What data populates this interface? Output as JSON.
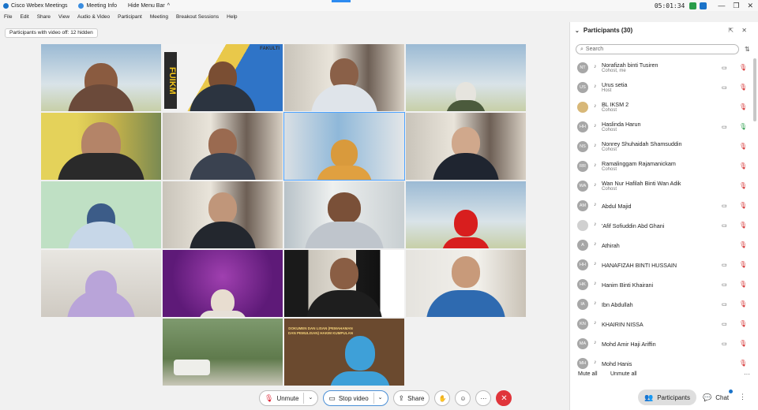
{
  "titlebar": {
    "app_name": "Cisco Webex Meetings",
    "meeting_info": "Meeting Info",
    "hide_menu_bar": "Hide Menu Bar",
    "chevron": "^",
    "timer": "05:01:34",
    "minimize": "—",
    "restore": "❐",
    "close": "✕"
  },
  "menubar": [
    "File",
    "Edit",
    "Share",
    "View",
    "Audio & Video",
    "Participant",
    "Meeting",
    "Breakout Sessions",
    "Help"
  ],
  "hidden_notice": "Participants with video off: 12 hidden",
  "toolbar": {
    "unmute": "Unmute",
    "stop_video": "Stop video",
    "share": "Share",
    "caret": "⌄",
    "reactions_icon": "☺",
    "more_icon": "···",
    "end_icon": "✕"
  },
  "panel": {
    "title": "Participants (30)",
    "search_placeholder": "Search",
    "mute_all": "Mute all",
    "unmute_all": "Unmute all",
    "participants_tab": "Participants",
    "chat_tab": "Chat",
    "participants": [
      {
        "initials": "NT",
        "name": "Norafizah binti Tusiren",
        "role": "Cohost, me",
        "cam": true,
        "mic": "muted"
      },
      {
        "initials": "US",
        "name": "Urus setia",
        "role": "Host",
        "cam": true,
        "mic": "muted"
      },
      {
        "initials": "",
        "name": "BL IKSM 2",
        "role": "Cohost",
        "cam": false,
        "mic": "muted",
        "image": true
      },
      {
        "initials": "HH",
        "name": "Haslinda Harun",
        "role": "Cohost",
        "cam": true,
        "mic": "on"
      },
      {
        "initials": "NS",
        "name": "Nonrey Shuhaidah Shamsuddin",
        "role": "Cohost",
        "cam": false,
        "mic": "muted"
      },
      {
        "initials": "RR",
        "name": "Ramalinggam Rajamanickam",
        "role": "Cohost",
        "cam": false,
        "mic": "muted"
      },
      {
        "initials": "WA",
        "name": "Wan Nur Hafilah Binti Wan Adik",
        "role": "Cohost",
        "cam": false,
        "mic": "muted"
      },
      {
        "initials": "AM",
        "name": "Abdul Majid",
        "role": "",
        "cam": true,
        "mic": "muted"
      },
      {
        "initials": "",
        "name": "'Afif Sofiuddin Abd Ghani",
        "role": "",
        "cam": true,
        "mic": "muted"
      },
      {
        "initials": "A",
        "name": "Athirah",
        "role": "",
        "cam": false,
        "mic": "muted"
      },
      {
        "initials": "HH",
        "name": "HANAFIZAH BINTI HUSSAIN",
        "role": "",
        "cam": true,
        "mic": "muted"
      },
      {
        "initials": "HK",
        "name": "Hanim Binti Khairani",
        "role": "",
        "cam": true,
        "mic": "muted"
      },
      {
        "initials": "IA",
        "name": "Ibn Abdullah",
        "role": "",
        "cam": true,
        "mic": "muted"
      },
      {
        "initials": "KN",
        "name": "KHAIRIN NISSA",
        "role": "",
        "cam": true,
        "mic": "muted"
      },
      {
        "initials": "MA",
        "name": "Mohd Amir Haji Ariffin",
        "role": "",
        "cam": true,
        "mic": "muted"
      },
      {
        "initials": "MH",
        "name": "Mohd Hanis",
        "role": "",
        "cam": false,
        "mic": "muted"
      }
    ]
  },
  "tile_text": {
    "fakulti_banner": "FAKULTI",
    "fakulti_side": "FUIKM",
    "slide_title": "DOKUMEN DAN LISAN (PEMAHAMAN DAN PEMULISAN) HAKIM KUMPULAN"
  },
  "colors": {
    "accent": "#4da3ff",
    "end_call": "#e0353b",
    "mic_muted": "#d42a2a",
    "mic_on": "#2a9d4a"
  }
}
